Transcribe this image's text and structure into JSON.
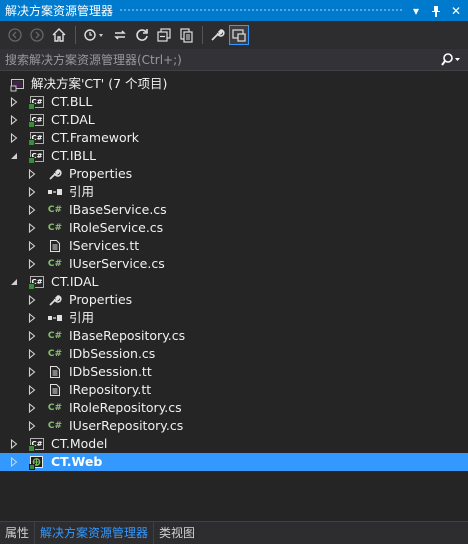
{
  "window": {
    "title": "解决方案资源管理器"
  },
  "search": {
    "placeholder": "搜索解决方案资源管理器(Ctrl+;)"
  },
  "tree": [
    {
      "label": "解决方案'CT' (7 个项目)",
      "icon": "solution-icon",
      "expander": "none",
      "depth": 0
    },
    {
      "label": "CT.BLL",
      "icon": "csharp-project-icon",
      "expander": "collapsed",
      "depth": 0
    },
    {
      "label": "CT.DAL",
      "icon": "csharp-project-icon",
      "expander": "collapsed",
      "depth": 0
    },
    {
      "label": "CT.Framework",
      "icon": "csharp-project-icon",
      "expander": "collapsed",
      "depth": 0
    },
    {
      "label": "CT.IBLL",
      "icon": "csharp-project-icon",
      "expander": "expanded",
      "depth": 0
    },
    {
      "label": "Properties",
      "icon": "wrench-icon",
      "expander": "collapsed",
      "depth": 1
    },
    {
      "label": "引用",
      "icon": "references-icon",
      "expander": "collapsed",
      "depth": 1
    },
    {
      "label": "IBaseService.cs",
      "icon": "csharp-file-icon",
      "expander": "collapsed",
      "depth": 1
    },
    {
      "label": "IRoleService.cs",
      "icon": "csharp-file-icon",
      "expander": "collapsed",
      "depth": 1
    },
    {
      "label": "IServices.tt",
      "icon": "text-file-icon",
      "expander": "collapsed",
      "depth": 1
    },
    {
      "label": "IUserService.cs",
      "icon": "csharp-file-icon",
      "expander": "collapsed",
      "depth": 1
    },
    {
      "label": "CT.IDAL",
      "icon": "csharp-project-icon",
      "expander": "expanded",
      "depth": 0
    },
    {
      "label": "Properties",
      "icon": "wrench-icon",
      "expander": "collapsed",
      "depth": 1
    },
    {
      "label": "引用",
      "icon": "references-icon",
      "expander": "collapsed",
      "depth": 1
    },
    {
      "label": "IBaseRepository.cs",
      "icon": "csharp-file-icon",
      "expander": "collapsed",
      "depth": 1
    },
    {
      "label": "IDbSession.cs",
      "icon": "csharp-file-icon",
      "expander": "collapsed",
      "depth": 1
    },
    {
      "label": "IDbSession.tt",
      "icon": "text-file-icon",
      "expander": "collapsed",
      "depth": 1
    },
    {
      "label": "IRepository.tt",
      "icon": "text-file-icon",
      "expander": "collapsed",
      "depth": 1
    },
    {
      "label": "IRoleRepository.cs",
      "icon": "csharp-file-icon",
      "expander": "collapsed",
      "depth": 1
    },
    {
      "label": "IUserRepository.cs",
      "icon": "csharp-file-icon",
      "expander": "collapsed",
      "depth": 1
    },
    {
      "label": "CT.Model",
      "icon": "csharp-project-icon",
      "expander": "collapsed",
      "depth": 0
    },
    {
      "label": "CT.Web",
      "icon": "web-project-icon",
      "expander": "collapsed",
      "depth": 0,
      "selected": true
    }
  ],
  "bottom_tabs": [
    {
      "label": "属性",
      "active": false
    },
    {
      "label": "解决方案资源管理器",
      "active": true
    },
    {
      "label": "类视图",
      "active": false
    }
  ],
  "colors": {
    "accent": "#007acc",
    "selection": "#3399ff",
    "background": "#252526"
  }
}
